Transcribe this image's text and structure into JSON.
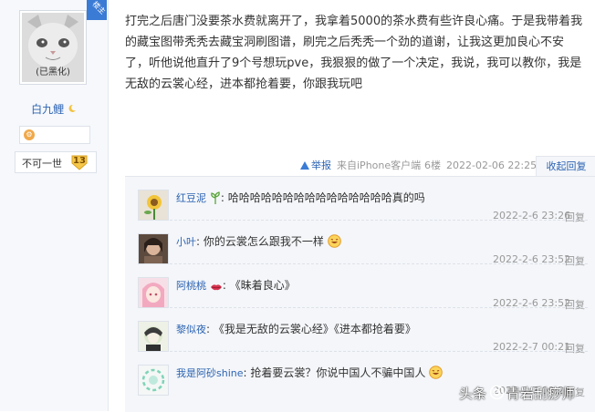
{
  "user": {
    "avatar_caption": "(已黑化)",
    "louzhu_badge": "楼主",
    "name": "白九鲤",
    "level_title": "不可一世",
    "level_number": "13"
  },
  "post": {
    "text": "打完之后唐门没要茶水费就离开了，我拿着5000的茶水费有些许良心痛。于是我带着我的藏宝图带秃秃去藏宝洞刷图谱，刷完之后秃秃一个劲的道谢，让我这更加良心不安了，听他说他直升了9个号想玩pve，我狠狠的做了一个决定，我说，我可以教你，我是无敌的云裳心经，进本都抢着要，你跟我玩吧",
    "report_label": "举报",
    "client": "来自iPhone客户端",
    "floor": "6楼",
    "datetime": "2022-02-06 22:25",
    "collapse_label": "收起回复"
  },
  "replies": [
    {
      "name": "红豆泥",
      "content": "哈哈哈哈哈哈哈哈哈哈哈哈哈哈哈真的吗",
      "date": "2022-2-6 23:26",
      "reply": "回复"
    },
    {
      "name": "小叶",
      "content": "你的云裳怎么跟我不一样",
      "date": "2022-2-6 23:52",
      "reply": "回复"
    },
    {
      "name": "阿桃桃",
      "content": "《昧着良心》",
      "date": "2022-2-6 23:52",
      "reply": "回复"
    },
    {
      "name": "黎似夜",
      "content": "《我是无敌的云裳心经》《进本都抢着要》",
      "date": "2022-2-7 00:21",
      "reply": "回复"
    },
    {
      "name": "我是阿砂shine",
      "content": "抢着要云裳？你说中国人不骗中国人",
      "date": "2022-2-7 00:24",
      "reply": "回复"
    }
  ],
  "watermark": {
    "left": "头条",
    "right": "青岩刮痧师"
  },
  "colors": {
    "link_blue": "#2d64b3",
    "reply_bg": "#f4f6f9",
    "meta_gray": "#999999"
  }
}
